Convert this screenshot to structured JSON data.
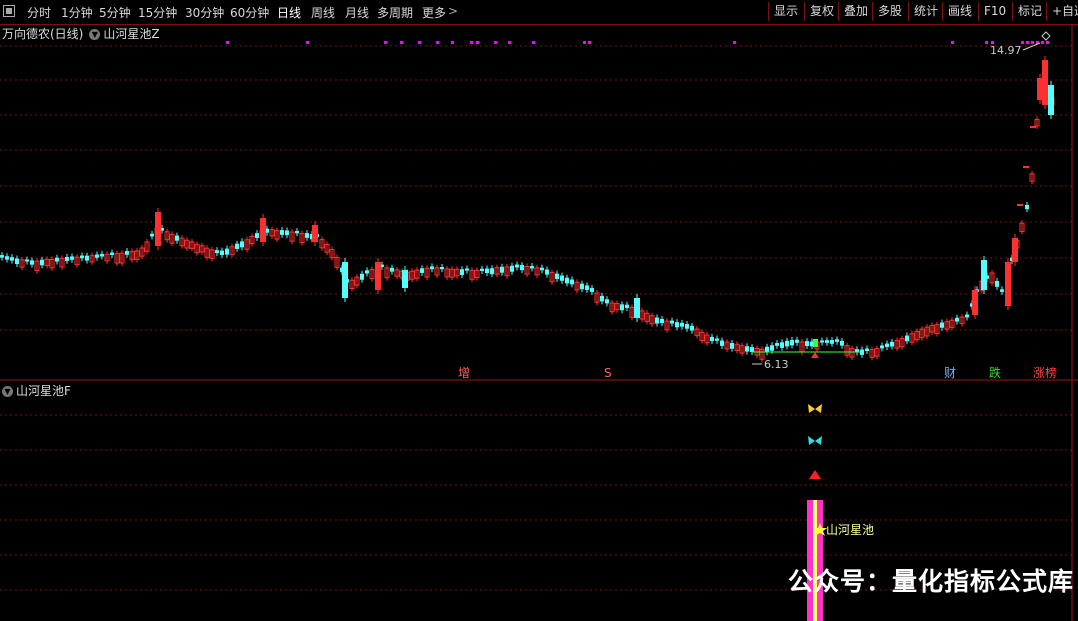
{
  "toolbar": {
    "periods": [
      "分时",
      "1分钟",
      "5分钟",
      "15分钟",
      "30分钟",
      "60分钟",
      "日线",
      "周线",
      "月线",
      "多周期",
      "更多"
    ],
    "active_period": "日线",
    "right_buttons": [
      "显示",
      "复权",
      "叠加",
      "多股",
      "统计",
      "画线",
      "F10",
      "标记",
      "+自选"
    ]
  },
  "header": {
    "stock_title": "万向德农(日线)",
    "indicator_name": "山河星池Z"
  },
  "sub_panel": {
    "indicator_name": "山河星池F",
    "signal_label": "山河星池"
  },
  "price_labels": {
    "high": "14.97",
    "low": "6.13"
  },
  "event_badges": [
    {
      "text": "增",
      "color": "#ff6060",
      "bg": "#000"
    },
    {
      "text": "S",
      "color": "#ff6060",
      "bg": "#000"
    },
    {
      "text": "财",
      "color": "#6fb6ff",
      "bg": "#000"
    },
    {
      "text": "跌",
      "color": "#38d438",
      "bg": "#000"
    },
    {
      "text": "涨榜",
      "color": "#ff4040",
      "bg": "#000"
    }
  ],
  "watermark": "公众号：量化指标公式库",
  "colors": {
    "up": "#ff3030",
    "down": "#54ffff",
    "grid": "#7a1010",
    "marker": "#ff00ff",
    "signal_bar": "#ff33cc",
    "signal_core": "#ffff66"
  }
}
